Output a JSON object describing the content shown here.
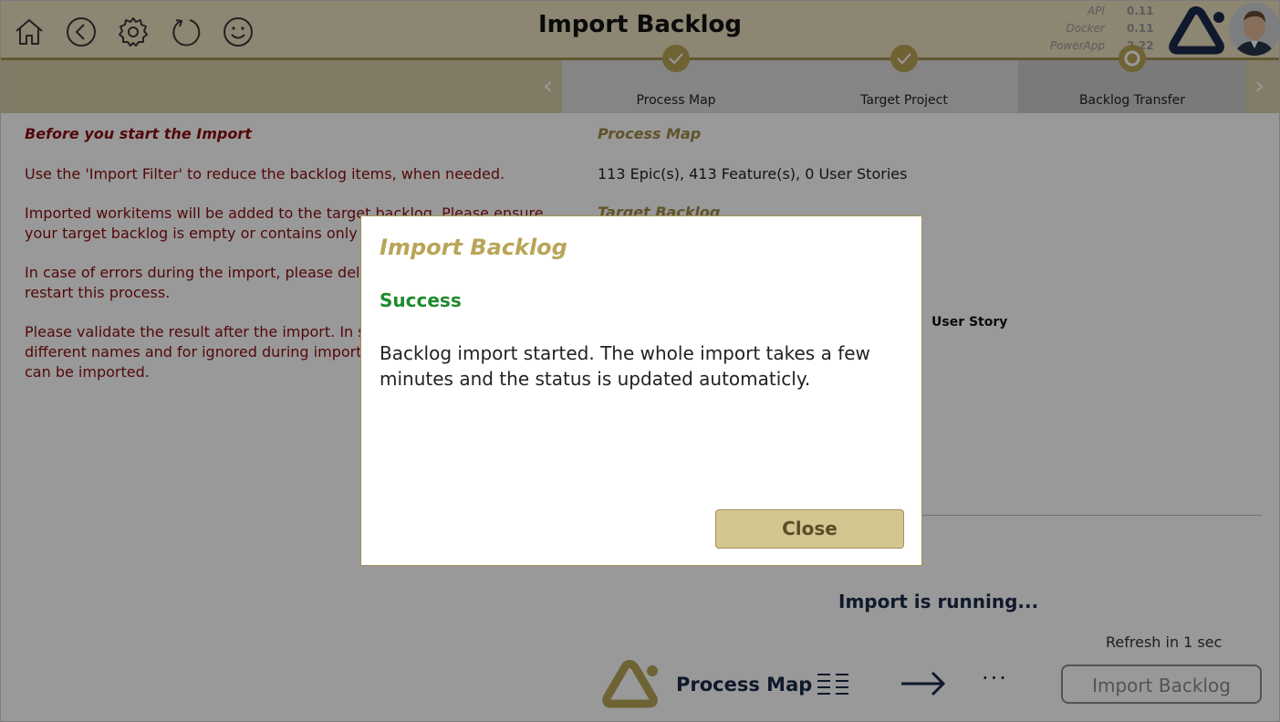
{
  "header": {
    "title": "Import Backlog",
    "versions": [
      {
        "label": "API",
        "value": "0.11"
      },
      {
        "label": "Docker",
        "value": "0.11"
      },
      {
        "label": "PowerApp",
        "value": "2.22"
      }
    ]
  },
  "stepper": {
    "steps": [
      {
        "label": "Process Map",
        "state": "done"
      },
      {
        "label": "Target Project",
        "state": "done"
      },
      {
        "label": "Backlog Transfer",
        "state": "current"
      }
    ]
  },
  "left": {
    "heading": "Before you start the Import",
    "paragraphs": [
      "Use the 'Import Filter' to reduce the backlog items, when needed.",
      "Imported workitems will be added to the target backlog. Please ensure your target backlog is empty or contains only",
      "In case of errors during the import, please del workitems before you restart this process.",
      "Please validate the result after the import. In s elements might have different names and for ignored during import. In other words, only m can be imported."
    ]
  },
  "right": {
    "process_map_heading": "Process Map",
    "process_map_summary": "113 Epic(s), 413 Feature(s), 0 User Stories",
    "target_backlog_heading": "Target Backlog",
    "user_story_label": "User Story",
    "running_text": "Import is running...",
    "refresh_text": "Refresh in 1 sec"
  },
  "footer": {
    "process_map_label": "Process Map",
    "dots": "···",
    "import_button": "Import Backlog"
  },
  "dialog": {
    "title": "Import Backlog",
    "status": "Success",
    "message": "Backlog import started. The whole import takes a few minutes and the status is updated automaticly.",
    "close_button": "Close"
  },
  "colors": {
    "header_bg": "#e9dfbf",
    "accent_gold": "#b8a557",
    "dark_red_text": "#8b0e12",
    "success_green": "#1f8a2c",
    "navy": "#1b2a4a"
  }
}
